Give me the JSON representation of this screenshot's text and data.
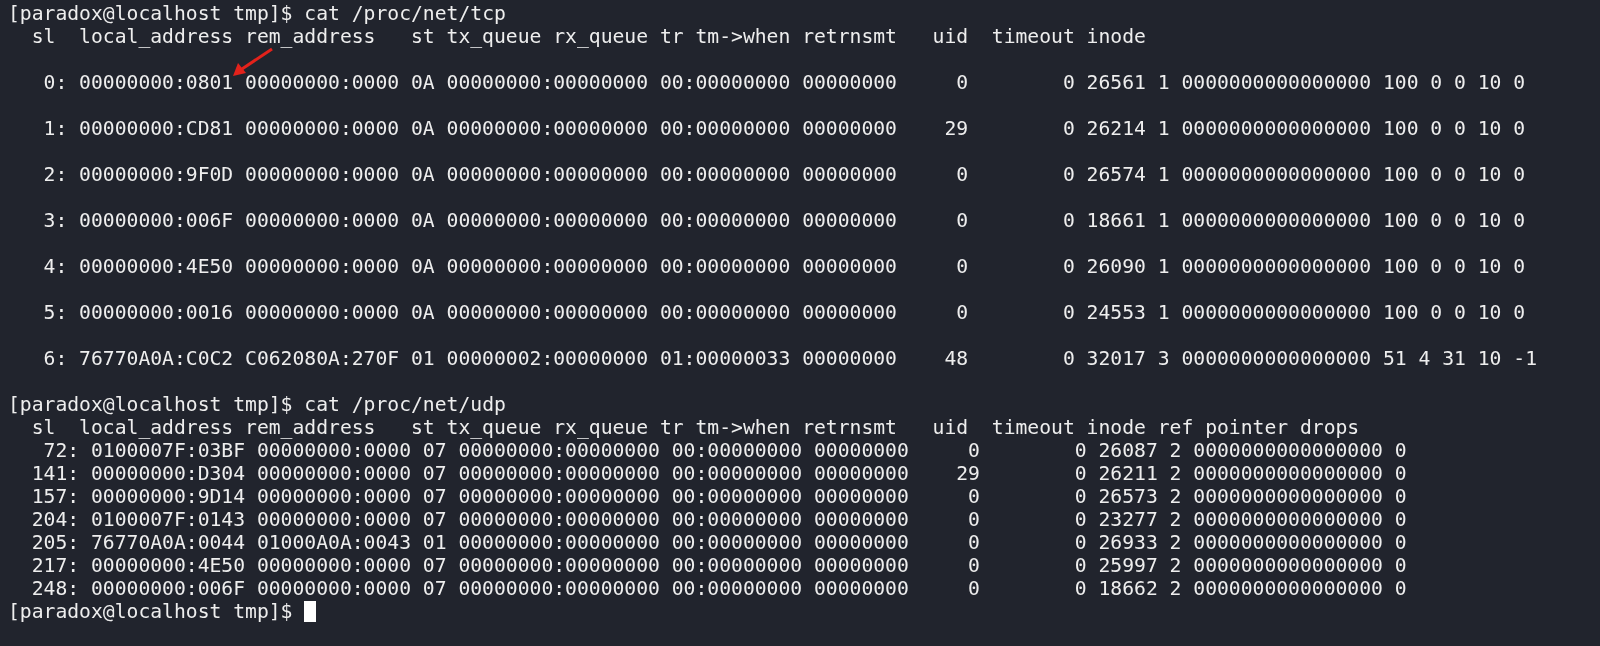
{
  "terminal": {
    "blocks": [
      {
        "prompt": "[paradox@localhost tmp]$",
        "command": "cat /proc/net/tcp",
        "spaced_rows": true,
        "header": "  sl  local_address rem_address   st tx_queue rx_queue tr tm->when retrnsmt   uid  timeout inode",
        "rows": [
          "   0: 00000000:0801 00000000:0000 0A 00000000:00000000 00:00000000 00000000     0        0 26561 1 0000000000000000 100 0 0 10 0",
          "   1: 00000000:CD81 00000000:0000 0A 00000000:00000000 00:00000000 00000000    29        0 26214 1 0000000000000000 100 0 0 10 0",
          "   2: 00000000:9F0D 00000000:0000 0A 00000000:00000000 00:00000000 00000000     0        0 26574 1 0000000000000000 100 0 0 10 0",
          "   3: 00000000:006F 00000000:0000 0A 00000000:00000000 00:00000000 00000000     0        0 18661 1 0000000000000000 100 0 0 10 0",
          "   4: 00000000:4E50 00000000:0000 0A 00000000:00000000 00:00000000 00000000     0        0 26090 1 0000000000000000 100 0 0 10 0",
          "   5: 00000000:0016 00000000:0000 0A 00000000:00000000 00:00000000 00000000     0        0 24553 1 0000000000000000 100 0 0 10 0",
          "   6: 76770A0A:C0C2 C062080A:270F 01 00000002:00000000 01:00000033 00000000    48        0 32017 3 0000000000000000 51 4 31 10 -1"
        ]
      },
      {
        "prompt": "[paradox@localhost tmp]$",
        "command": "cat /proc/net/udp",
        "spaced_rows": false,
        "header": "  sl  local_address rem_address   st tx_queue rx_queue tr tm->when retrnsmt   uid  timeout inode ref pointer drops",
        "rows": [
          "   72: 0100007F:03BF 00000000:0000 07 00000000:00000000 00:00000000 00000000     0        0 26087 2 0000000000000000 0",
          "  141: 00000000:D304 00000000:0000 07 00000000:00000000 00:00000000 00000000    29        0 26211 2 0000000000000000 0",
          "  157: 00000000:9D14 00000000:0000 07 00000000:00000000 00:00000000 00000000     0        0 26573 2 0000000000000000 0",
          "  204: 0100007F:0143 00000000:0000 07 00000000:00000000 00:00000000 00000000     0        0 23277 2 0000000000000000 0",
          "  205: 76770A0A:0044 01000A0A:0043 01 00000000:00000000 00:00000000 00000000     0        0 26933 2 0000000000000000 0",
          "  217: 00000000:4E50 00000000:0000 07 00000000:00000000 00:00000000 00000000     0        0 25997 2 0000000000000000 0",
          "  248: 00000000:006F 00000000:0000 07 00000000:00000000 00:00000000 00000000     0        0 18662 2 0000000000000000 0"
        ]
      }
    ],
    "final_prompt": "[paradox@localhost tmp]$"
  }
}
